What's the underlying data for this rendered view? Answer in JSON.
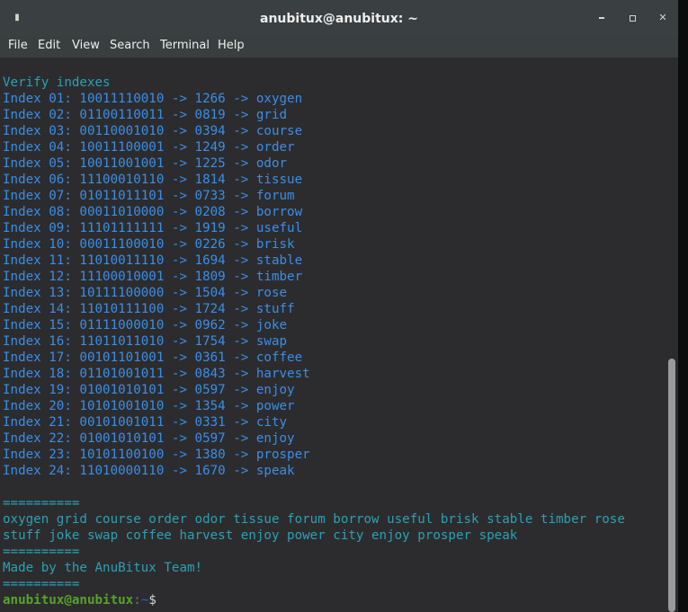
{
  "window": {
    "title": "anubitux@anubitux: ~"
  },
  "menu": [
    {
      "label": "File"
    },
    {
      "label": "Edit"
    },
    {
      "label": "View"
    },
    {
      "label": "Search"
    },
    {
      "label": "Terminal"
    },
    {
      "label": "Help"
    }
  ],
  "terminal": {
    "heading": "Verify indexes",
    "indexes": [
      "Index 01: 10011110010 -> 1266 -> oxygen",
      "Index 02: 01100110011 -> 0819 -> grid",
      "Index 03: 00110001010 -> 0394 -> course",
      "Index 04: 10011100001 -> 1249 -> order",
      "Index 05: 10011001001 -> 1225 -> odor",
      "Index 06: 11100010110 -> 1814 -> tissue",
      "Index 07: 01011011101 -> 0733 -> forum",
      "Index 08: 00011010000 -> 0208 -> borrow",
      "Index 09: 11101111111 -> 1919 -> useful",
      "Index 10: 00011100010 -> 0226 -> brisk",
      "Index 11: 11010011110 -> 1694 -> stable",
      "Index 12: 11100010001 -> 1809 -> timber",
      "Index 13: 10111100000 -> 1504 -> rose",
      "Index 14: 11010111100 -> 1724 -> stuff",
      "Index 15: 01111000010 -> 0962 -> joke",
      "Index 16: 11011011010 -> 1754 -> swap",
      "Index 17: 00101101001 -> 0361 -> coffee",
      "Index 18: 01101001011 -> 0843 -> harvest",
      "Index 19: 01001010101 -> 0597 -> enjoy",
      "Index 20: 10101001010 -> 1354 -> power",
      "Index 21: 00101001011 -> 0331 -> city",
      "Index 22: 01001010101 -> 0597 -> enjoy",
      "Index 23: 10101100100 -> 1380 -> prosper",
      "Index 24: 11010000110 -> 1670 -> speak"
    ],
    "separator": "==========",
    "mnemonic_line1": "oxygen grid course order odor tissue forum borrow useful brisk stable timber rose",
    "mnemonic_line2": "stuff joke swap coffee harvest enjoy power city enjoy prosper speak",
    "credit": "Made by the AnuBitux Team!",
    "prompt_user": "anubitux@anubitux",
    "prompt_sep": ":",
    "prompt_path": "~",
    "prompt_dollar": "$"
  },
  "colors": {
    "index_text": "#3a8ee6",
    "cyan_text": "#2aa1b3",
    "prompt_user": "#5aa02c",
    "terminal_bg": "#2c2c2f"
  },
  "icons": {
    "window_menu": "window-menu-icon",
    "minimize": "minimize-icon",
    "maximize": "maximize-icon",
    "close": "close-icon"
  }
}
